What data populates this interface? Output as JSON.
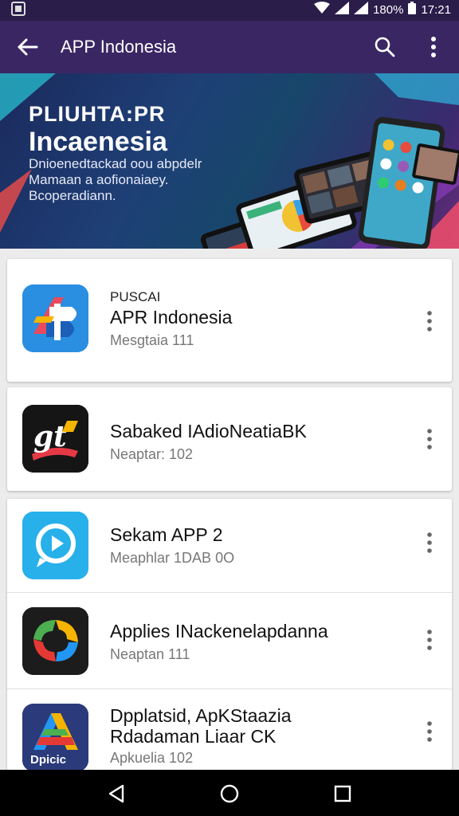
{
  "status_bar": {
    "battery": "180%",
    "time": "17:21"
  },
  "app_bar": {
    "title": "APP Indonesia"
  },
  "banner": {
    "title_line1": "PLIUHTA:PR",
    "title_line2": "Incaenesia",
    "subtitle_line1": "Dnioenedtackad oou abpdelr",
    "subtitle_line2": "Mamaan a aofionaiaey.",
    "subtitle_line3": "Bcoperadiann."
  },
  "apps": [
    {
      "label": "PUSCAI",
      "name": "APR Indonesia",
      "meta": "Mesgtaia 111",
      "icon": "apr-logo-icon"
    },
    {
      "name": "Sabaked IAdioNeatiaBK",
      "meta": "Neaptar: 102",
      "icon": "gt-logo-icon"
    },
    {
      "name": "Sekam APP 2",
      "meta": "Meaphlar 1DAB 0O",
      "icon": "play-chat-icon"
    },
    {
      "name": "Applies INackenelapdanna",
      "meta": "Neaptan 111",
      "icon": "swirl-logo-icon"
    },
    {
      "name_line1": "Dpplatsid, ApKStaazia",
      "name_line2": "Rdadaman Liaar CK",
      "meta": "Apkuelia 102",
      "icon": "opticic-logo-icon",
      "icon_text": "Dpicic"
    }
  ],
  "colors": {
    "status_bar": "#2a1d4a",
    "app_bar": "#3a2663",
    "card_bg": "#ffffff",
    "page_bg": "#ececec"
  }
}
